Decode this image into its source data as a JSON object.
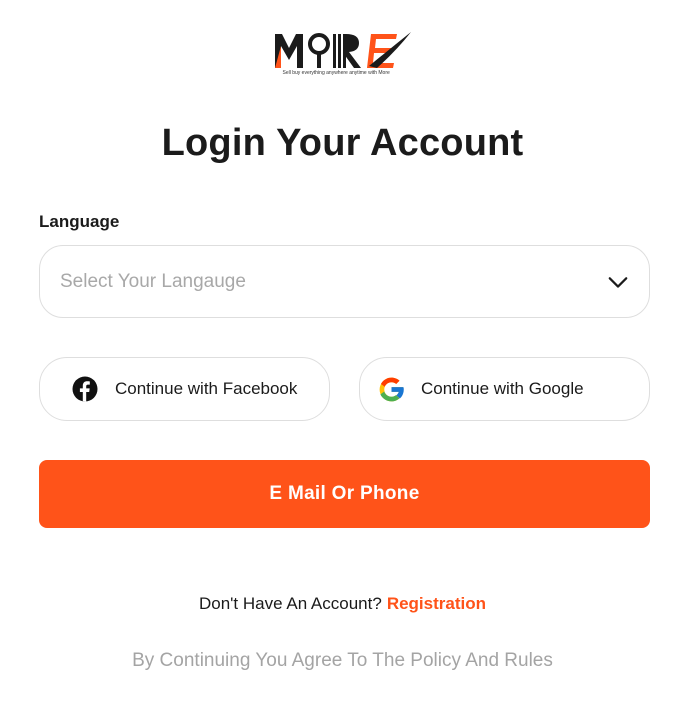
{
  "brand": {
    "logo_text": "MORE",
    "tagline": "Sell buy everything anywhere anytime with More",
    "accent_color": "#ff5319"
  },
  "title": "Login Your Account",
  "language": {
    "label": "Language",
    "placeholder": "Select Your Langauge",
    "icon": "chevron-down-icon"
  },
  "social": {
    "facebook": {
      "label": "Continue with Facebook",
      "icon": "facebook-icon"
    },
    "google": {
      "label": "Continue with Google",
      "icon": "google-icon"
    }
  },
  "primary_button": {
    "label": "E Mail Or Phone"
  },
  "account_prompt": {
    "text": "Don't Have An Account?",
    "link": "Registration"
  },
  "policy": "By Continuing You Agree To The Policy And Rules"
}
